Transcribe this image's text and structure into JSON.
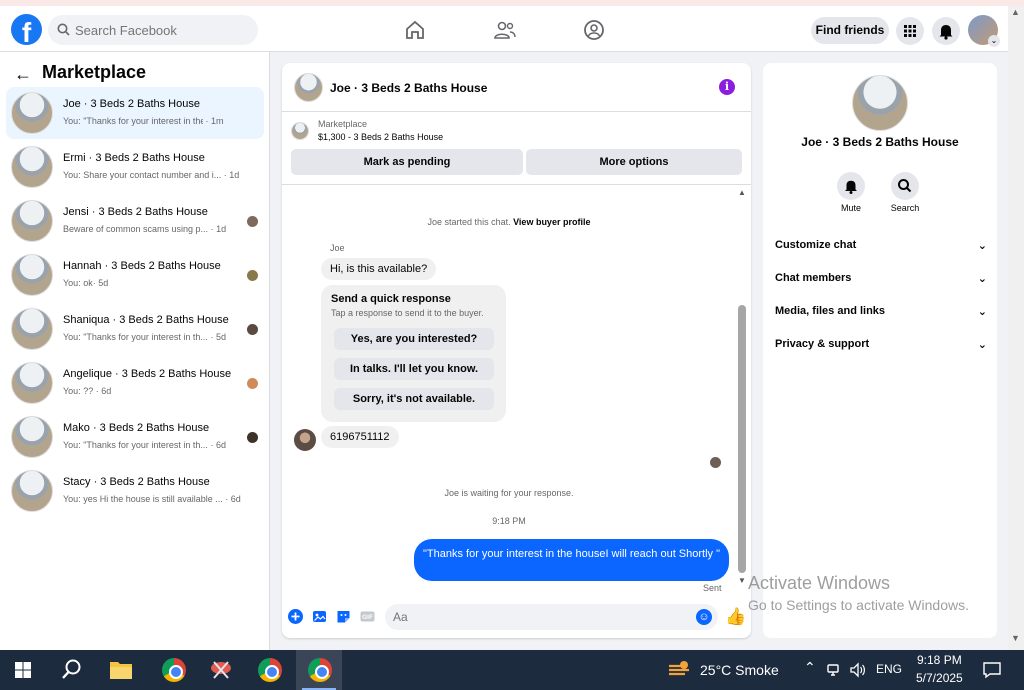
{
  "header": {
    "search_placeholder": "Search Facebook",
    "find_friends_label": "Find friends"
  },
  "sidebar": {
    "title": "Marketplace",
    "conversations": [
      {
        "name": "Joe · 3 Beds 2 Baths House",
        "snippet": "You: \"Thanks for your interest in the house",
        "time": "· 1m"
      },
      {
        "name": "Ermi · 3 Beds 2 Baths House",
        "snippet": "You: Share your contact number and i...",
        "time": "· 1d"
      },
      {
        "name": "Jensi · 3 Beds 2 Baths House",
        "snippet": "Beware of common scams using p...",
        "time": "· 1d"
      },
      {
        "name": "Hannah · 3 Beds 2 Baths House",
        "snippet": "You: ok",
        "time": "· 5d"
      },
      {
        "name": "Shaniqua · 3 Beds 2 Baths House",
        "snippet": "You: \"Thanks for your interest in th...",
        "time": "· 5d"
      },
      {
        "name": "Angelique · 3 Beds 2 Baths House",
        "snippet": "You: ??",
        "time": "· 6d"
      },
      {
        "name": "Mako · 3 Beds 2 Baths House",
        "snippet": "You: \"Thanks for your interest in th...",
        "time": "· 6d"
      },
      {
        "name": "Stacy · 3 Beds 2 Baths House",
        "snippet": "You: yes Hi the house is still available ...",
        "time": "· 6d"
      }
    ]
  },
  "chat": {
    "title": "Joe · 3 Beds 2 Baths House",
    "listing_label": "Marketplace",
    "listing_price": "$1,300 - 3 Beds 2 Baths House",
    "mark_pending_label": "Mark as pending",
    "more_options_label": "More options",
    "started_text": "Joe started this chat.",
    "view_profile_link": "View buyer profile",
    "sender_name": "Joe",
    "first_message": "Hi, is this available?",
    "quick_response_title": "Send a quick response",
    "quick_response_sub": "Tap a response to send it to the buyer.",
    "quick_responses": [
      "Yes, are you interested?",
      "In talks. I'll let you know.",
      "Sorry, it's not available."
    ],
    "phone_message": "6196751112",
    "waiting_text": "Joe is waiting for your response.",
    "timestamp": "9:18 PM",
    "outgoing_message": "\"Thanks for your interest in the houseI will reach out Shortly \"",
    "sent_label": "Sent",
    "composer_placeholder": "Aa"
  },
  "details": {
    "name": "Joe · 3 Beds 2 Baths House",
    "mute_label": "Mute",
    "search_label": "Search",
    "sections": [
      "Customize chat",
      "Chat members",
      "Media, files and links",
      "Privacy & support"
    ]
  },
  "watermark": {
    "line1": "Activate Windows",
    "line2": "Go to Settings to activate Windows."
  },
  "taskbar": {
    "weather": "25°C  Smoke",
    "language": "ENG",
    "time": "9:18 PM",
    "date": "5/7/2025"
  },
  "colors": {
    "brand": "#1877f2",
    "outgoing_bubble": "#0a66ff",
    "info_icon": "#8b1de0"
  }
}
